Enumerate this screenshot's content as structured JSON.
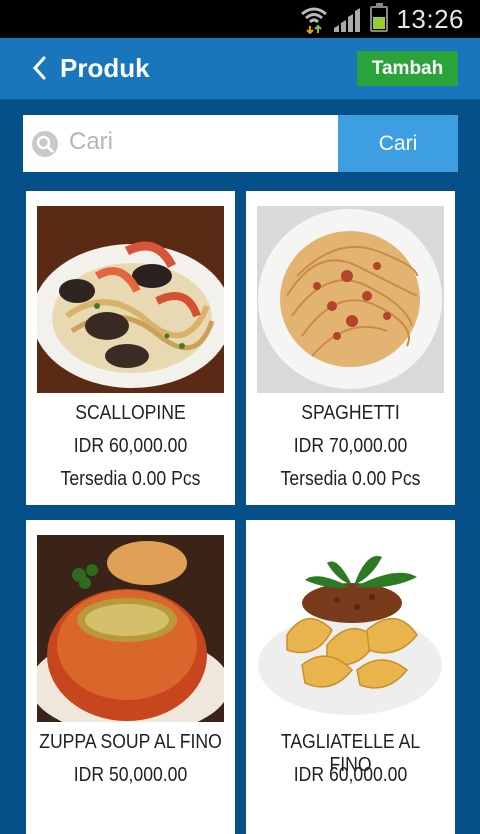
{
  "status": {
    "time": "13:26"
  },
  "appbar": {
    "title": "Produk",
    "add_label": "Tambah"
  },
  "search": {
    "placeholder": "Cari",
    "value": "",
    "button_label": "Cari"
  },
  "products": [
    {
      "name": "SCALLOPINE",
      "price": "IDR 60,000.00",
      "stock": "Tersedia 0.00 Pcs"
    },
    {
      "name": "SPAGHETTI",
      "price": "IDR 70,000.00",
      "stock": "Tersedia 0.00 Pcs"
    },
    {
      "name": "ZUPPA SOUP AL FINO",
      "price": "IDR 50,000.00",
      "stock": ""
    },
    {
      "name": "TAGLIATELLE AL FINO",
      "price": "IDR 60,000.00",
      "stock": ""
    }
  ]
}
